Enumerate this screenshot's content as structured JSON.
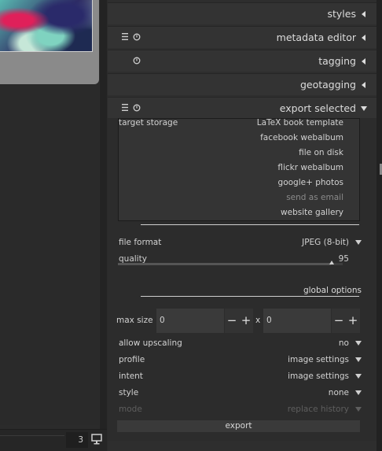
{
  "status_bar": {
    "count": "3",
    "monitor_icon": "monitor-icon"
  },
  "modules": {
    "styles": {
      "title": "styles",
      "state": "collapsed"
    },
    "metadata_editor": {
      "title": "metadata editor",
      "state": "collapsed"
    },
    "tagging": {
      "title": "tagging",
      "state": "collapsed"
    },
    "geotagging": {
      "title": "geotagging",
      "state": "collapsed"
    },
    "export_selected": {
      "title": "export selected",
      "state": "expanded"
    }
  },
  "export": {
    "target_storage_label": "target storage",
    "storages": [
      {
        "label": "LaTeX book template",
        "enabled": true
      },
      {
        "label": "facebook webalbum",
        "enabled": true
      },
      {
        "label": "file on disk",
        "enabled": true
      },
      {
        "label": "flickr webalbum",
        "enabled": true
      },
      {
        "label": "google+ photos",
        "enabled": true
      },
      {
        "label": "send as email",
        "enabled": false
      },
      {
        "label": "website gallery",
        "enabled": true
      }
    ],
    "file_format_label": "file format",
    "file_format_value": "JPEG (8-bit)",
    "quality_label": "quality",
    "quality_value": "95",
    "quality_fraction": 0.95,
    "global_options_label": "global options",
    "max_size_label": "max size",
    "max_width": "0",
    "max_height": "0",
    "x_separator": "x",
    "minus": "−",
    "plus": "+",
    "allow_upscaling_label": "allow upscaling",
    "allow_upscaling_value": "no",
    "profile_label": "profile",
    "profile_value": "image settings",
    "intent_label": "intent",
    "intent_value": "image settings",
    "style_label": "style",
    "style_value": "none",
    "mode_label": "mode",
    "mode_value": "replace history",
    "export_button": "export"
  },
  "colors": {
    "panel": "#2e2e2e",
    "header": "#333333",
    "text": "#d2d2d2",
    "disabled": "#5e5e5e"
  }
}
